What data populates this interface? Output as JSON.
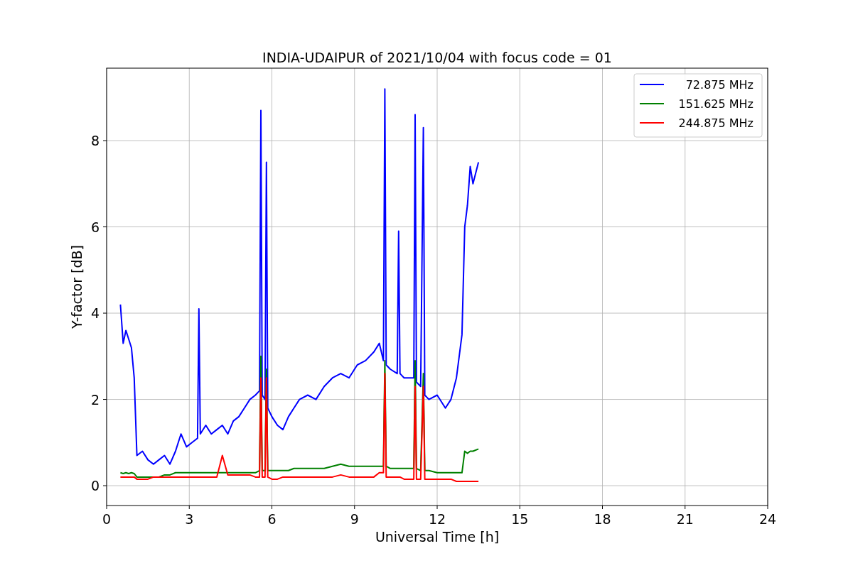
{
  "chart_data": {
    "type": "line",
    "title": "INDIA-UDAIPUR of 2021/10/04 with focus code = 01",
    "xlabel": "Universal Time [h]",
    "ylabel": "Y-factor [dB]",
    "x": [
      0.5,
      0.6,
      0.7,
      0.8,
      0.9,
      1.0,
      1.1,
      1.3,
      1.5,
      1.7,
      1.9,
      2.1,
      2.3,
      2.5,
      2.7,
      2.9,
      3.1,
      3.3,
      3.35,
      3.4,
      3.6,
      3.8,
      4.0,
      4.2,
      4.4,
      4.6,
      4.8,
      5.0,
      5.2,
      5.4,
      5.55,
      5.6,
      5.65,
      5.75,
      5.8,
      5.85,
      6.0,
      6.2,
      6.4,
      6.6,
      6.8,
      7.0,
      7.3,
      7.6,
      7.9,
      8.2,
      8.5,
      8.8,
      9.1,
      9.4,
      9.7,
      9.9,
      10.05,
      10.1,
      10.15,
      10.3,
      10.55,
      10.6,
      10.65,
      10.8,
      11.0,
      11.15,
      11.2,
      11.25,
      11.4,
      11.5,
      11.55,
      11.7,
      12.0,
      12.3,
      12.5,
      12.7,
      12.9,
      13.0,
      13.1,
      13.2,
      13.3,
      13.5
    ],
    "series": [
      {
        "name": "72.875 MHz",
        "color": "#0000ff",
        "values": [
          4.2,
          3.3,
          3.6,
          3.4,
          3.2,
          2.5,
          0.7,
          0.8,
          0.6,
          0.5,
          0.6,
          0.7,
          0.5,
          0.8,
          1.2,
          0.9,
          1.0,
          1.1,
          4.1,
          1.2,
          1.4,
          1.2,
          1.3,
          1.4,
          1.2,
          1.5,
          1.6,
          1.8,
          2.0,
          2.1,
          2.2,
          8.7,
          2.1,
          2.0,
          7.5,
          1.8,
          1.6,
          1.4,
          1.3,
          1.6,
          1.8,
          2.0,
          2.1,
          2.0,
          2.3,
          2.5,
          2.6,
          2.5,
          2.8,
          2.9,
          3.1,
          3.3,
          2.9,
          9.2,
          2.8,
          2.7,
          2.6,
          5.9,
          2.6,
          2.5,
          2.5,
          2.5,
          8.6,
          2.4,
          2.3,
          8.3,
          2.1,
          2.0,
          2.1,
          1.8,
          2.0,
          2.5,
          3.5,
          6.0,
          6.5,
          7.4,
          7.0,
          7.5
        ]
      },
      {
        "name": "151.625 MHz",
        "color": "#008000",
        "values": [
          0.3,
          0.28,
          0.3,
          0.28,
          0.3,
          0.28,
          0.2,
          0.2,
          0.2,
          0.2,
          0.2,
          0.25,
          0.25,
          0.3,
          0.3,
          0.3,
          0.3,
          0.3,
          0.3,
          0.3,
          0.3,
          0.3,
          0.3,
          0.3,
          0.3,
          0.3,
          0.3,
          0.3,
          0.3,
          0.3,
          0.35,
          3.0,
          0.35,
          0.35,
          2.7,
          0.35,
          0.35,
          0.35,
          0.35,
          0.35,
          0.4,
          0.4,
          0.4,
          0.4,
          0.4,
          0.45,
          0.5,
          0.45,
          0.45,
          0.45,
          0.45,
          0.45,
          0.45,
          2.9,
          0.45,
          0.4,
          0.4,
          0.4,
          0.4,
          0.4,
          0.4,
          0.4,
          2.9,
          0.4,
          0.35,
          2.6,
          0.35,
          0.35,
          0.3,
          0.3,
          0.3,
          0.3,
          0.3,
          0.8,
          0.75,
          0.8,
          0.8,
          0.85
        ]
      },
      {
        "name": "244.875 MHz",
        "color": "#ff0000",
        "values": [
          0.2,
          0.2,
          0.2,
          0.2,
          0.2,
          0.2,
          0.15,
          0.15,
          0.15,
          0.2,
          0.2,
          0.2,
          0.2,
          0.2,
          0.2,
          0.2,
          0.2,
          0.2,
          0.2,
          0.2,
          0.2,
          0.2,
          0.2,
          0.7,
          0.25,
          0.25,
          0.25,
          0.25,
          0.25,
          0.2,
          0.2,
          2.5,
          0.2,
          0.2,
          2.5,
          0.2,
          0.15,
          0.15,
          0.2,
          0.2,
          0.2,
          0.2,
          0.2,
          0.2,
          0.2,
          0.2,
          0.25,
          0.2,
          0.2,
          0.2,
          0.2,
          0.3,
          0.3,
          2.6,
          0.2,
          0.2,
          0.2,
          0.2,
          0.2,
          0.15,
          0.15,
          0.15,
          2.3,
          0.15,
          0.15,
          2.3,
          0.15,
          0.15,
          0.15,
          0.15,
          0.15,
          0.1,
          0.1,
          0.1,
          0.1,
          0.1,
          0.1,
          0.1
        ]
      }
    ],
    "xlim": [
      0,
      24
    ],
    "ylim": [
      -0.46,
      9.68
    ],
    "xticks": [
      0,
      3,
      6,
      9,
      12,
      15,
      18,
      21,
      24
    ],
    "yticks": [
      0,
      2,
      4,
      6,
      8
    ],
    "grid": true,
    "legend": true
  }
}
